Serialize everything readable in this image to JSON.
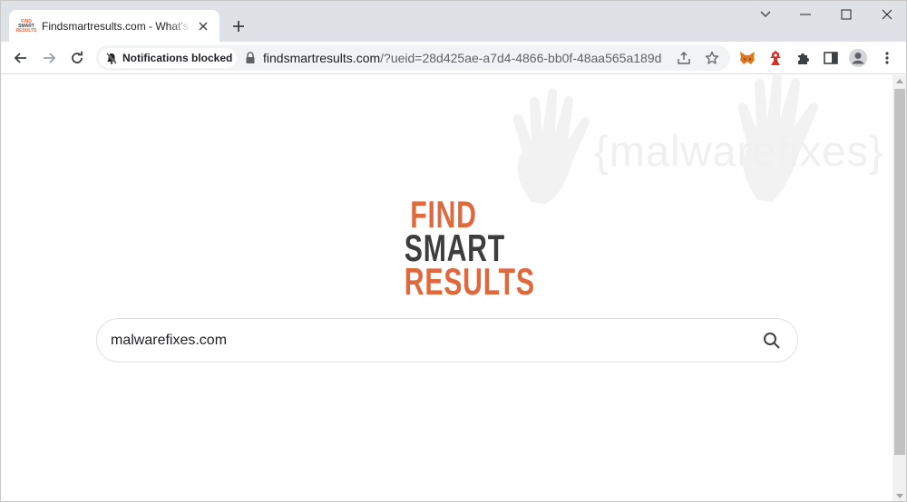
{
  "tab": {
    "title": "Findsmartresults.com - What's Your Search?",
    "favicon_text": [
      "FIND",
      "SMART",
      "RESULTS"
    ],
    "favicon_icon": "findsmartresults-favicon",
    "close_icon": "close-icon"
  },
  "window_controls": {
    "tab_search_icon": "chevron-down-icon",
    "minimize_icon": "minimize-icon",
    "maximize_icon": "maximize-icon",
    "close_icon": "close-icon"
  },
  "toolbar": {
    "back_icon": "arrow-left-icon",
    "forward_icon": "arrow-right-icon",
    "reload_icon": "reload-icon",
    "notifications_label": "Notifications blocked",
    "notifications_icon": "bell-off-icon",
    "lock_icon": "lock-icon",
    "url_host": "findsmartresults.com",
    "url_path": "/?ueid=28d425ae-a7d4-4866-bb0f-48aa565a189d",
    "share_icon": "share-icon",
    "bookmark_icon": "star-icon",
    "extensions": [
      "metamask-fox-icon",
      "extension-red-icon",
      "puzzle-icon"
    ],
    "sidepanel_icon": "side-panel-icon",
    "profile_icon": "profile-avatar-icon",
    "menu_icon": "kebab-menu-icon"
  },
  "watermark": {
    "text": "{malwarefixes}",
    "icon": "handprint-icon"
  },
  "logo": {
    "line1": "FIND",
    "line2": "SMART",
    "line3": "RESULTS",
    "colors": {
      "accent": "#e0683d",
      "dark": "#3d3d3d"
    }
  },
  "search": {
    "value": "malwarefixes.com",
    "icon": "search-icon"
  }
}
